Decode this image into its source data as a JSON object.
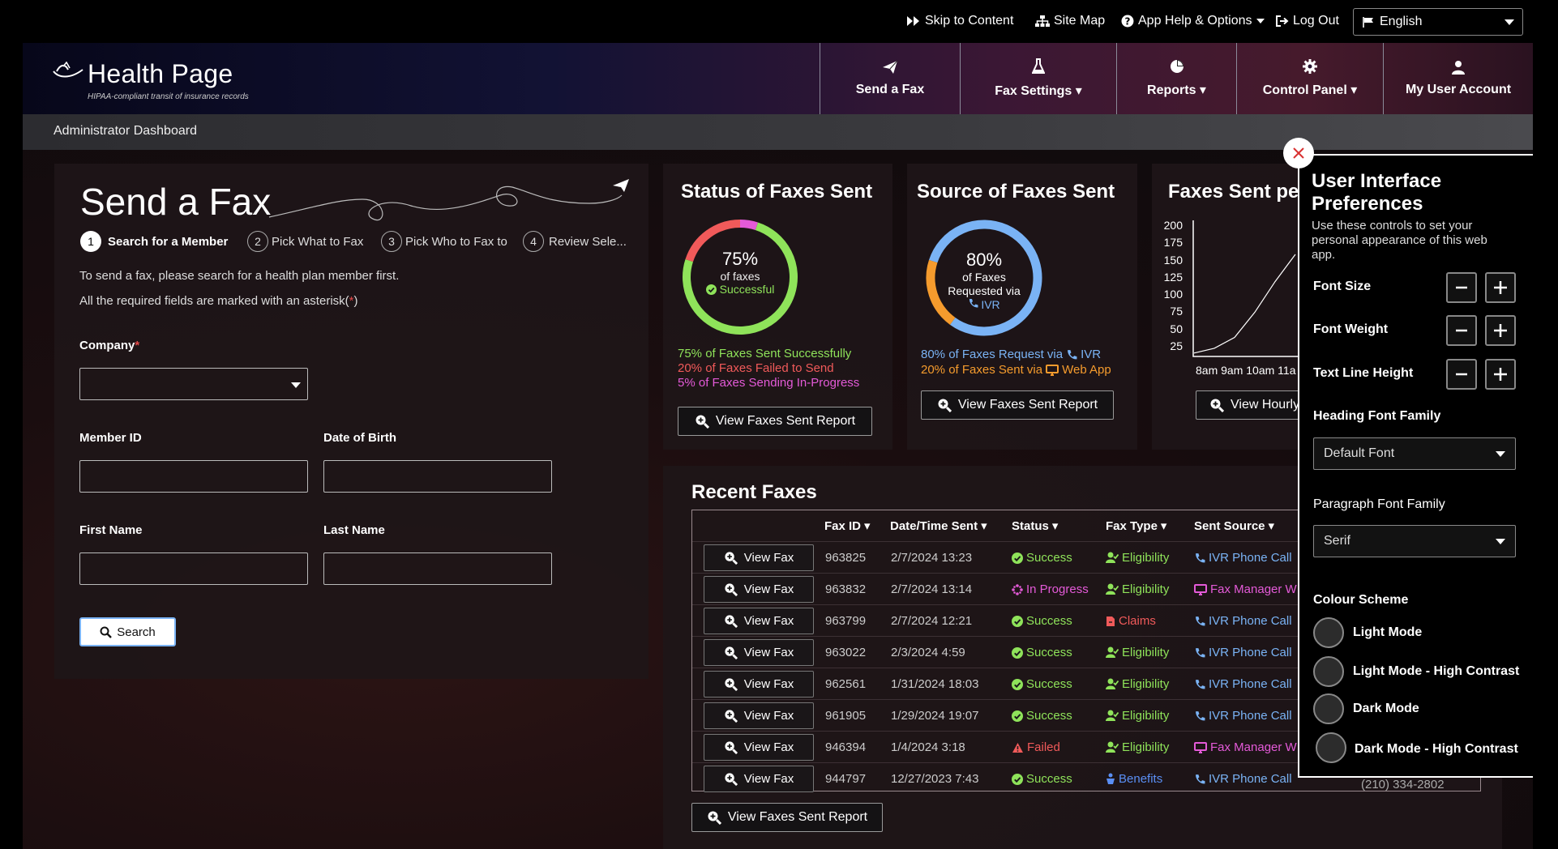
{
  "colors": {
    "success": "#8fe35a",
    "failed": "#f15a5a",
    "in_progress": "#e45ad8",
    "ivr": "#7ab3f5",
    "web_app": "#f59b2d",
    "claims": "#f15a5a",
    "benefits": "#5a8ff5"
  },
  "utility": {
    "skip": "Skip to Content",
    "sitemap": "Site Map",
    "help": "App Help & Options",
    "logout": "Log Out",
    "language": "English"
  },
  "brand": {
    "name": "Health Page",
    "tagline": "HIPAA-compliant transit of insurance records"
  },
  "nav": {
    "send_fax": "Send a Fax",
    "fax_settings": "Fax Settings",
    "reports": "Reports",
    "control_panel": "Control Panel",
    "my_account": "My User Account"
  },
  "breadcrumb": "Administrator Dashboard",
  "send_fax": {
    "title": "Send a Fax",
    "steps": [
      {
        "num": "1",
        "label": "Search for a Member"
      },
      {
        "num": "2",
        "label": "Pick What to Fax"
      },
      {
        "num": "3",
        "label": "Pick Who to Fax to"
      },
      {
        "num": "4",
        "label": "Review Sele..."
      }
    ],
    "intro": "To send a fax, please search for a health plan member first.",
    "required_note_prefix": "All the required fields are marked with an asterisk(",
    "required_note_star": "*",
    "required_note_suffix": ")",
    "company_label": "Company",
    "company_star": "*",
    "member_id_label": "Member ID",
    "dob_label": "Date of Birth",
    "first_name_label": "First Name",
    "last_name_label": "Last Name",
    "search_label": "Search"
  },
  "status_card": {
    "title": "Status of Faxes Sent",
    "center_pct": "75%",
    "center_line1": "of faxes",
    "center_line2": "Successful",
    "legend": [
      "75% of Faxes Sent Successfully",
      "20% of Faxes Failed to Send",
      "5% of Faxes Sending In-Progress"
    ],
    "button": "View Faxes Sent Report"
  },
  "source_card": {
    "title": "Source of Faxes Sent",
    "center_pct": "80%",
    "center_line1": "of Faxes",
    "center_line2": "Requested via",
    "center_line3": "IVR",
    "legend_1_prefix": "80% of Faxes Request via",
    "legend_1_suffix": "IVR",
    "legend_2_prefix": "20% of Faxes Sent via",
    "legend_2_suffix": "Web App",
    "button": "View Faxes Sent Report"
  },
  "hourly_card": {
    "title": "Faxes Sent pe",
    "y_ticks": [
      "200",
      "175",
      "150",
      "125",
      "100",
      "75",
      "50",
      "25"
    ],
    "x_ticks": "8am 9am 10am 11a",
    "button": "View Hourly"
  },
  "chart_data": {
    "type": "line",
    "title": "Faxes Sent pe",
    "categories": [
      "8am",
      "9am",
      "10am",
      "11a"
    ],
    "series": [
      {
        "values": [
          5,
          12,
          28,
          65,
          110,
          150
        ]
      }
    ],
    "ylim": [
      0,
      200
    ],
    "grid": false,
    "donuts": [
      {
        "name": "Status of Faxes Sent",
        "slices": [
          {
            "label": "Successful",
            "value": 75
          },
          {
            "label": "Failed",
            "value": 20
          },
          {
            "label": "In-Progress",
            "value": 5
          }
        ]
      },
      {
        "name": "Source of Faxes Sent",
        "slices": [
          {
            "label": "IVR",
            "value": 80
          },
          {
            "label": "Web App",
            "value": 20
          }
        ]
      }
    ]
  },
  "recent": {
    "title": "Recent Faxes",
    "headers": [
      "Fax ID",
      "Date/Time Sent",
      "Status",
      "Fax Type",
      "Sent Source"
    ],
    "view_label": "View Fax",
    "rows": [
      {
        "id": "963825",
        "date": "2/7/2024 13:23",
        "status": "Success",
        "type": "Eligibility",
        "source": "IVR Phone Call"
      },
      {
        "id": "963832",
        "date": "2/7/2024 13:14",
        "status": "In Progress",
        "type": "Eligibility",
        "source": "Fax Manager W"
      },
      {
        "id": "963799",
        "date": "2/7/2024 12:21",
        "status": "Success",
        "type": "Claims",
        "source": "IVR Phone Call"
      },
      {
        "id": "963022",
        "date": "2/3/2024 4:59",
        "status": "Success",
        "type": "Eligibility",
        "source": "IVR Phone Call"
      },
      {
        "id": "962561",
        "date": "1/31/2024 18:03",
        "status": "Success",
        "type": "Eligibility",
        "source": "IVR Phone Call"
      },
      {
        "id": "961905",
        "date": "1/29/2024 19:07",
        "status": "Success",
        "type": "Eligibility",
        "source": "IVR Phone Call"
      },
      {
        "id": "946394",
        "date": "1/4/2024 3:18",
        "status": "Failed",
        "type": "Eligibility",
        "source": "Fax Manager W"
      },
      {
        "id": "944797",
        "date": "12/27/2023 7:43",
        "status": "Success",
        "type": "Benefits",
        "source": "IVR Phone Call"
      }
    ],
    "clipped_phone": "(210) 334-2802",
    "button": "View Faxes Sent Report"
  },
  "prefs": {
    "title_line1": "User Interface",
    "title_line2": "Preferences",
    "desc_line1": "Use these controls to set your",
    "desc_line2": "personal appearance of this web",
    "desc_line3": "app.",
    "font_size": "Font Size",
    "font_weight": "Font Weight",
    "line_height": "Text Line Height",
    "heading_family": "Heading Font Family",
    "heading_value": "Default Font",
    "paragraph_family": "Paragraph Font Family",
    "paragraph_value": "Serif",
    "colour_scheme": "Colour Scheme",
    "schemes": [
      "Light Mode",
      "Light Mode - High Contrast",
      "Dark Mode",
      "Dark Mode - High Contrast"
    ]
  }
}
